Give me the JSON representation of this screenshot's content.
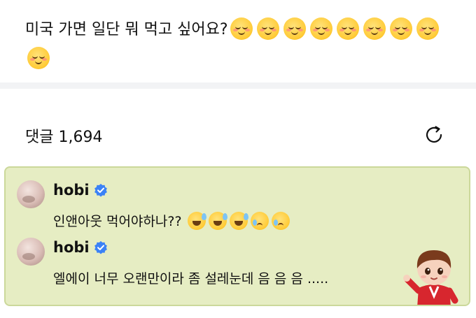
{
  "post": {
    "text": "미국 가면 일단 뭐 먹고 싶어요?",
    "emoji_name": "smiling-face-emoji",
    "emoji_count": 9
  },
  "comments_section": {
    "label": "댓글 1,694",
    "refresh_icon": "refresh-icon"
  },
  "comments": [
    {
      "author": "hobi",
      "verified": true,
      "text": "인앤아웃 먹어야하나?? ",
      "emojis": [
        "grinning-sweat-emoji",
        "grinning-sweat-emoji",
        "grinning-sweat-emoji",
        "crying-face-emoji",
        "crying-face-emoji"
      ]
    },
    {
      "author": "hobi",
      "verified": true,
      "text": "엘에이 너무 오랜만이라 좀 설레눈데 음 음 음 .....",
      "sticker": "character-sticker"
    }
  ],
  "colors": {
    "panel_bg": "#e6edc3",
    "verified_badge": "#3b82f6"
  }
}
